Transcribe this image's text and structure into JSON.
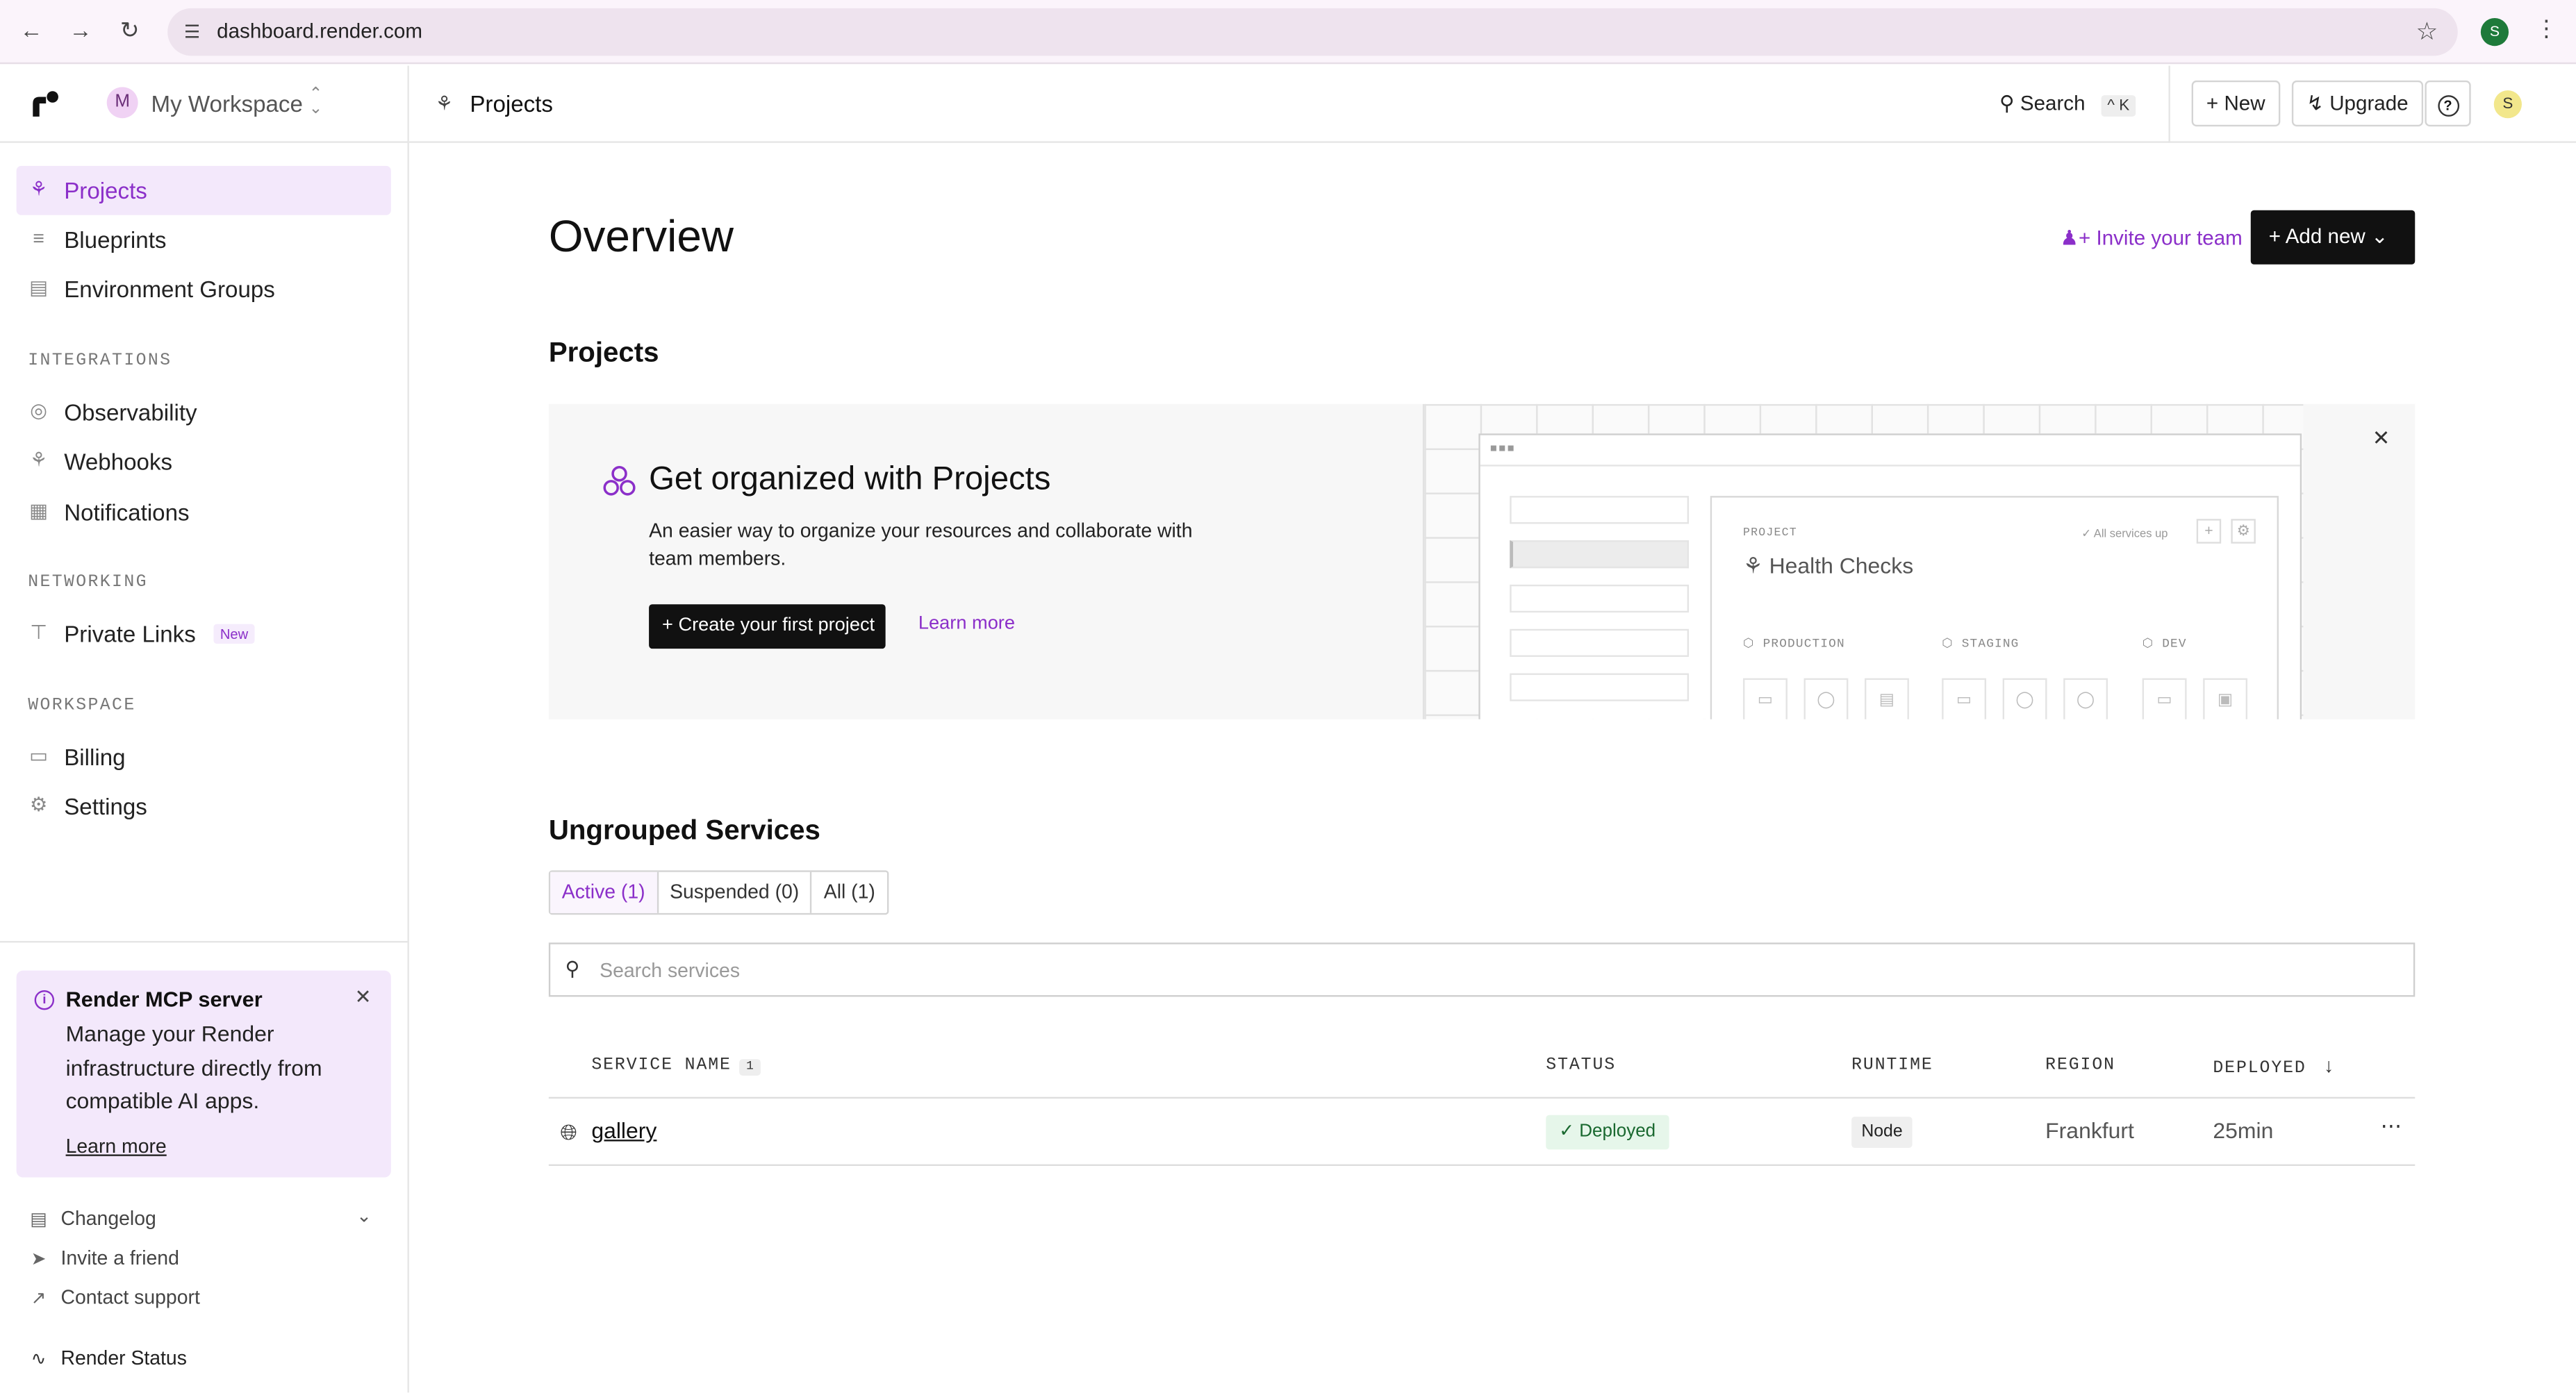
{
  "browser": {
    "url": "dashboard.render.com",
    "profile_initial": "S"
  },
  "sidebar": {
    "workspace_initial": "M",
    "workspace_name": "My Workspace",
    "items": [
      {
        "label": "Projects",
        "icon": "projects-icon",
        "active": true
      },
      {
        "label": "Blueprints",
        "icon": "blueprints-icon"
      },
      {
        "label": "Environment Groups",
        "icon": "env-groups-icon"
      }
    ],
    "sections": [
      {
        "title": "INTEGRATIONS",
        "items": [
          {
            "label": "Observability",
            "icon": "observability-icon"
          },
          {
            "label": "Webhooks",
            "icon": "webhooks-icon"
          },
          {
            "label": "Notifications",
            "icon": "notifications-icon"
          }
        ]
      },
      {
        "title": "NETWORKING",
        "items": [
          {
            "label": "Private Links",
            "icon": "private-links-icon",
            "badge": "New"
          }
        ]
      },
      {
        "title": "WORKSPACE",
        "items": [
          {
            "label": "Billing",
            "icon": "billing-icon"
          },
          {
            "label": "Settings",
            "icon": "settings-icon"
          }
        ]
      }
    ],
    "mcp": {
      "title": "Render MCP server",
      "body": "Manage your Render infrastructure directly from compatible AI apps.",
      "link": "Learn more"
    },
    "footer": [
      {
        "label": "Changelog"
      },
      {
        "label": "Invite a friend"
      },
      {
        "label": "Contact support"
      },
      {
        "label": "Render Status"
      }
    ]
  },
  "topbar": {
    "breadcrumb": "Projects",
    "search_label": "Search",
    "search_shortcut": "^ K",
    "new_label": "New",
    "upgrade_label": "Upgrade",
    "user_initial": "S"
  },
  "main": {
    "title": "Overview",
    "invite_label": "Invite your team",
    "add_new_label": "Add new",
    "projects_heading": "Projects",
    "promo": {
      "title": "Get organized with Projects",
      "description": "An easier way to organize your resources and collaborate with team members.",
      "button": "Create your first project",
      "link": "Learn more",
      "illustration": {
        "project_label": "PROJECT",
        "project_name": "Health Checks",
        "status": "All services up",
        "envs": [
          "PRODUCTION",
          "STAGING",
          "DEV"
        ]
      }
    },
    "ungrouped_heading": "Ungrouped Services",
    "tabs": [
      {
        "label": "Active (1)",
        "active": true
      },
      {
        "label": "Suspended (0)"
      },
      {
        "label": "All (1)"
      }
    ],
    "search_placeholder": "Search services",
    "table": {
      "columns": {
        "service_name": "SERVICE NAME",
        "service_count": "1",
        "status": "STATUS",
        "runtime": "RUNTIME",
        "region": "REGION",
        "deployed": "DEPLOYED"
      },
      "rows": [
        {
          "name": "gallery",
          "status": "Deployed",
          "runtime": "Node",
          "region": "Frankfurt",
          "deployed": "25min"
        }
      ]
    }
  }
}
